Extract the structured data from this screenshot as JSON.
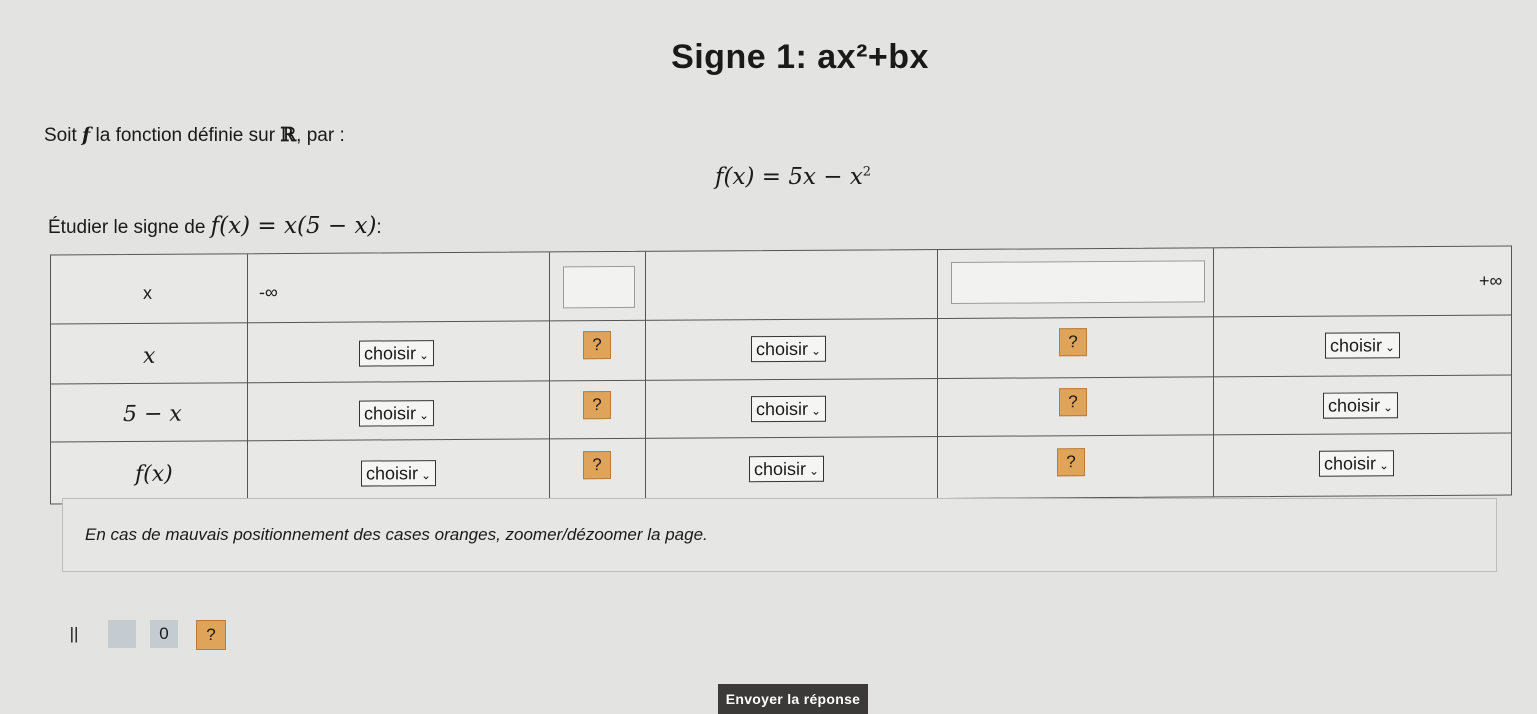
{
  "header": {
    "title": "Signe 1: ax²+bx"
  },
  "intro": {
    "text_before": "Soit ",
    "function_symbol": "f",
    "text_middle": " la fonction définie sur ",
    "domain_symbol": "ℝ",
    "text_after": ", par :"
  },
  "formula": {
    "lhs": "f(x) = 5x − x",
    "power": "2"
  },
  "study": {
    "text": "Étudier le signe de ",
    "expr": "f(x) = x(5 − x)",
    "colon": ":"
  },
  "table": {
    "header_label": "x",
    "minus_infinity": "-∞",
    "plus_infinity": "+∞",
    "rows": [
      {
        "label": "x",
        "selects": [
          "choisir",
          "choisir",
          "choisir"
        ],
        "markers": [
          "?",
          "?"
        ]
      },
      {
        "label": "5 − x",
        "selects": [
          "choisir",
          "choisir",
          "choisir"
        ],
        "markers": [
          "?",
          "?"
        ]
      },
      {
        "label": "f(x)",
        "selects": [
          "choisir",
          "choisir",
          "choisir"
        ],
        "markers": [
          "?",
          "?"
        ]
      }
    ]
  },
  "notice": {
    "text": "En cas de mauvais positionnement des cases oranges, zoomer/dézoomer la page."
  },
  "toolbar": {
    "pause": "||",
    "blank": "",
    "zero": "0",
    "help": "?"
  },
  "submit": {
    "label": "Envoyer la réponse"
  }
}
